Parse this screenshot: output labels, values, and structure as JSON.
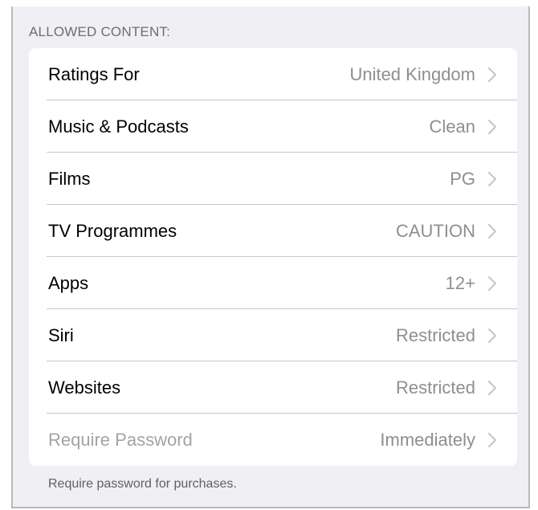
{
  "section": {
    "header": "ALLOWED CONTENT:",
    "footer": "Require password for purchases."
  },
  "rows": [
    {
      "label": "Ratings For",
      "value": "United Kingdom",
      "enabled": true
    },
    {
      "label": "Music & Podcasts",
      "value": "Clean",
      "enabled": true
    },
    {
      "label": "Films",
      "value": "PG",
      "enabled": true
    },
    {
      "label": "TV Programmes",
      "value": "CAUTION",
      "enabled": true
    },
    {
      "label": "Apps",
      "value": "12+",
      "enabled": true
    },
    {
      "label": "Siri",
      "value": "Restricted",
      "enabled": true
    },
    {
      "label": "Websites",
      "value": "Restricted",
      "enabled": true
    },
    {
      "label": "Require Password",
      "value": "Immediately",
      "enabled": false
    }
  ],
  "icons": {
    "disclosure": "chevron-right-icon"
  },
  "colors": {
    "background": "#efeff4",
    "cell": "#ffffff",
    "separator": "#c8c7cc",
    "secondary_text": "#8e8e93",
    "disabled_text": "#a3a3a8",
    "chevron": "#c7c7cc"
  }
}
